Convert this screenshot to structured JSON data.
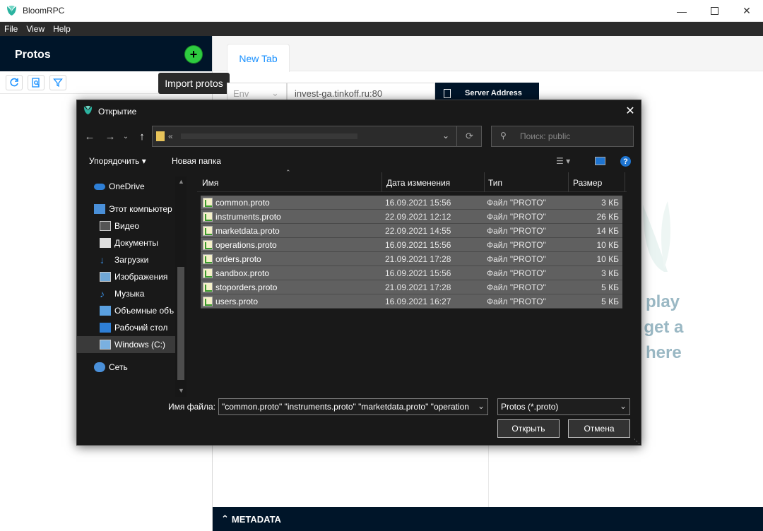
{
  "app": {
    "title": "BloomRPC"
  },
  "menu": [
    "File",
    "View",
    "Help"
  ],
  "left": {
    "title": "Protos",
    "import_tooltip": "Import protos"
  },
  "editor": {
    "tab": "New Tab",
    "env_placeholder": "Env",
    "server_address": "invest-ga.tinkoff.ru:80",
    "server_button": "Server Address",
    "hint_lines": [
      "play",
      "o get a",
      "e here"
    ],
    "metadata": "METADATA"
  },
  "dialog": {
    "title": "Открытие",
    "path_prefix": "«",
    "search_placeholder": "Поиск: public",
    "organize": "Упорядочить",
    "new_folder": "Новая папка",
    "columns": {
      "name": "Имя",
      "modified": "Дата изменения",
      "type": "Тип",
      "size": "Размер"
    },
    "tree": [
      {
        "label": "OneDrive",
        "icon": "cloud-icon"
      },
      {
        "label": "Этот компьютер",
        "icon": "computer-icon"
      },
      {
        "label": "Видео",
        "icon": "video-icon"
      },
      {
        "label": "Документы",
        "icon": "documents-icon"
      },
      {
        "label": "Загрузки",
        "icon": "downloads-icon"
      },
      {
        "label": "Изображения",
        "icon": "pictures-icon"
      },
      {
        "label": "Музыка",
        "icon": "music-icon"
      },
      {
        "label": "Объемные объ",
        "icon": "3d-objects-icon"
      },
      {
        "label": "Рабочий стол",
        "icon": "desktop-icon"
      },
      {
        "label": "Windows (C:)",
        "icon": "drive-icon"
      },
      {
        "label": "Сеть",
        "icon": "network-icon"
      }
    ],
    "files": [
      {
        "name": "common.proto",
        "modified": "16.09.2021 15:56",
        "type": "Файл \"PROTO\"",
        "size": "3 КБ"
      },
      {
        "name": "instruments.proto",
        "modified": "22.09.2021 12:12",
        "type": "Файл \"PROTO\"",
        "size": "26 КБ"
      },
      {
        "name": "marketdata.proto",
        "modified": "22.09.2021 14:55",
        "type": "Файл \"PROTO\"",
        "size": "14 КБ"
      },
      {
        "name": "operations.proto",
        "modified": "16.09.2021 15:56",
        "type": "Файл \"PROTO\"",
        "size": "10 КБ"
      },
      {
        "name": "orders.proto",
        "modified": "21.09.2021 17:28",
        "type": "Файл \"PROTO\"",
        "size": "10 КБ"
      },
      {
        "name": "sandbox.proto",
        "modified": "16.09.2021 15:56",
        "type": "Файл \"PROTO\"",
        "size": "3 КБ"
      },
      {
        "name": "stoporders.proto",
        "modified": "21.09.2021 17:28",
        "type": "Файл \"PROTO\"",
        "size": "5 КБ"
      },
      {
        "name": "users.proto",
        "modified": "16.09.2021 16:27",
        "type": "Файл \"PROTO\"",
        "size": "5 КБ"
      }
    ],
    "filename_label": "Имя файла:",
    "filename_value": "\"common.proto\" \"instruments.proto\" \"marketdata.proto\" \"operation",
    "filter": "Protos (*.proto)",
    "open": "Открыть",
    "cancel": "Отмена"
  },
  "colors": {
    "dark_nav": "#001529",
    "accent_green": "#2ecc40",
    "tab_blue": "#1890ff",
    "hint": "#9ab8c4"
  }
}
